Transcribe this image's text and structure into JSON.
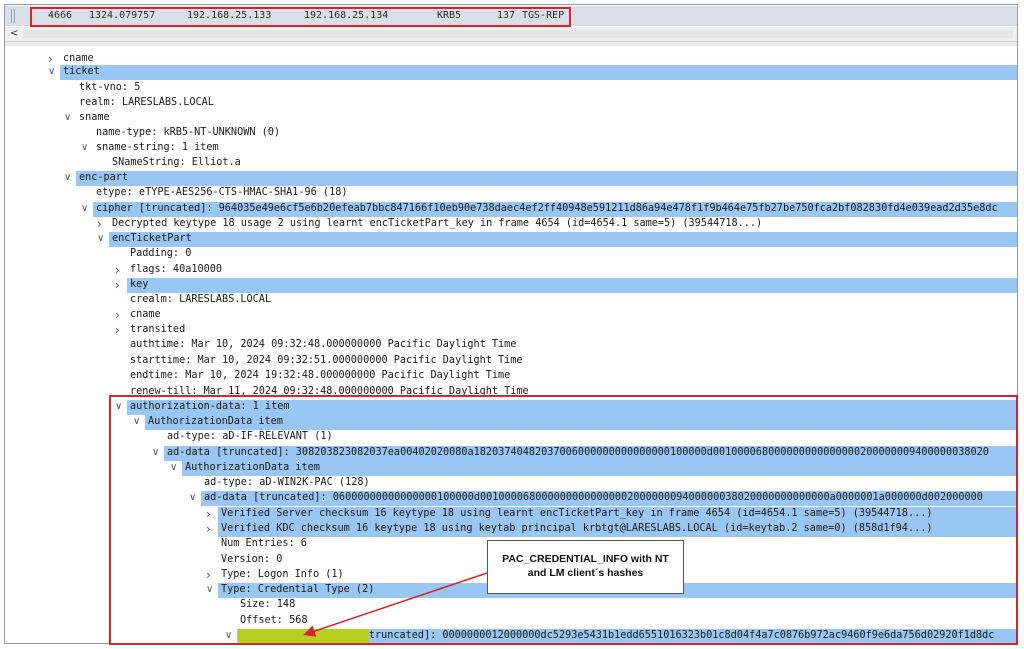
{
  "packet": {
    "number": "4666",
    "time": "1324.079757",
    "source": "192.168.25.133",
    "destination": "192.168.25.134",
    "protocol": "KRB5",
    "length": "137",
    "info": "TGS-REP"
  },
  "tree": [
    {
      "text": "cname",
      "toggle": "collapsed",
      "highlight": false
    },
    {
      "text": "ticket",
      "toggle": "expanded",
      "highlight": true
    },
    {
      "text": "tkt-vno: 5",
      "toggle": "none",
      "highlight": false
    },
    {
      "text": "realm: LARESLABS.LOCAL",
      "toggle": "none",
      "highlight": false
    },
    {
      "text": "sname",
      "toggle": "expanded",
      "highlight": false
    },
    {
      "text": "name-type: kRB5-NT-UNKNOWN (0)",
      "toggle": "none",
      "highlight": false
    },
    {
      "text": "sname-string: 1 item",
      "toggle": "expanded",
      "highlight": false
    },
    {
      "text": "SNameString: Elliot.a",
      "toggle": "none",
      "highlight": false
    },
    {
      "text": "enc-part",
      "toggle": "expanded",
      "highlight": true
    },
    {
      "text": "etype: eTYPE-AES256-CTS-HMAC-SHA1-96 (18)",
      "toggle": "none",
      "highlight": false
    },
    {
      "text": "cipher [truncated]: 964035e49e6cf5e6b20efeab7bbc847166f10eb90e738daec4ef2ff40948e591211d86a94e478f1f9b464e75fb27be750fca2bf082830fd4e039ead2d35e8dc",
      "toggle": "expanded",
      "highlight": true
    },
    {
      "text": "Decrypted keytype 18 usage 2 using learnt encTicketPart_key in frame 4654 (id=4654.1 same=5) (39544718...)",
      "toggle": "collapsed",
      "highlight": false
    },
    {
      "text": "encTicketPart",
      "toggle": "expanded",
      "highlight": true
    },
    {
      "text": "Padding: 0",
      "toggle": "none",
      "highlight": false
    },
    {
      "text": "flags: 40a10000",
      "toggle": "collapsed",
      "highlight": false
    },
    {
      "text": "key",
      "toggle": "collapsed",
      "highlight": true
    },
    {
      "text": "crealm: LARESLABS.LOCAL",
      "toggle": "none",
      "highlight": false
    },
    {
      "text": "cname",
      "toggle": "collapsed",
      "highlight": false
    },
    {
      "text": "transited",
      "toggle": "collapsed",
      "highlight": false
    },
    {
      "text": "authtime: Mar 10, 2024 09:32:48.000000000 Pacific Daylight Time",
      "toggle": "none",
      "highlight": false
    },
    {
      "text": "starttime: Mar 10, 2024 09:32:51.000000000 Pacific Daylight Time",
      "toggle": "none",
      "highlight": false
    },
    {
      "text": "endtime: Mar 10, 2024 19:32:48.000000000 Pacific Daylight Time",
      "toggle": "none",
      "highlight": false
    },
    {
      "text": "renew-till: Mar 11, 2024 09:32:48.000000000 Pacific Daylight Time",
      "toggle": "none",
      "highlight": false
    },
    {
      "text": "authorization-data: 1 item",
      "toggle": "expanded",
      "highlight": true
    },
    {
      "text": "AuthorizationData item",
      "toggle": "expanded",
      "highlight": true
    },
    {
      "text": "ad-type: aD-IF-RELEVANT (1)",
      "toggle": "none",
      "highlight": false
    },
    {
      "text": "ad-data [truncated]: 308203823082037ea00402020080a18203740482037006000000000000000100000d001000068000000000000000200000009400000038020",
      "toggle": "expanded",
      "highlight": true
    },
    {
      "text": "AuthorizationData item",
      "toggle": "expanded",
      "highlight": true
    },
    {
      "text": "ad-type: aD-WIN2K-PAC (128)",
      "toggle": "none",
      "highlight": false
    },
    {
      "text": "ad-data [truncated]: 06000000000000000100000d001000068000000000000000200000009400000038020000000000000a0000001a000000d002000000",
      "toggle": "expanded",
      "highlight": true
    },
    {
      "text": "Verified Server checksum 16 keytype 18 using learnt encTicketPart_key in frame 4654 (id=4654.1 same=5) (39544718...)",
      "toggle": "collapsed",
      "highlight": true
    },
    {
      "text": "Verified KDC checksum 16 keytype 18 using keytab principal krbtgt@LARESLABS.LOCAL (id=keytab.2 same=0) (858d1f94...)",
      "toggle": "collapsed",
      "highlight": true
    },
    {
      "text": "Num Entries: 6",
      "toggle": "none",
      "highlight": false
    },
    {
      "text": "Version: 0",
      "toggle": "none",
      "highlight": false
    },
    {
      "text": "Type: Logon Info (1)",
      "toggle": "collapsed",
      "highlight": false
    },
    {
      "text": "Type: Credential Type (2)",
      "toggle": "expanded",
      "highlight": true
    },
    {
      "text": "Size: 148",
      "toggle": "none",
      "highlight": false
    },
    {
      "text": "Offset: 568",
      "toggle": "none",
      "highlight": false
    },
    {
      "text": "PAC_CREDENTIAL_INFO [truncated]: 0000000012000000dc5293e5431b1edd6551016323b01c8d04f4a7c0876b972ac9460f9e6da756d02920f1d8dc",
      "toggle": "expanded",
      "highlight": true
    }
  ],
  "annotation": {
    "line1": "PAC_CREDENTIAL_INFO with NT",
    "line2": "and LM client´s hashes"
  }
}
